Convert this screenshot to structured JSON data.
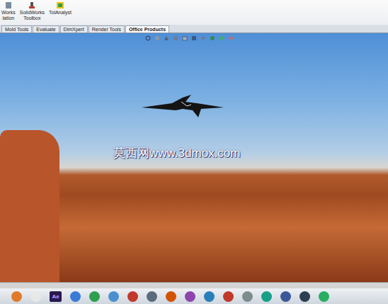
{
  "ribbon": {
    "items": [
      {
        "lines": [
          "Works",
          "lation"
        ]
      },
      {
        "lines": [
          "SolidWorks",
          "Toolbox"
        ]
      },
      {
        "lines": [
          "TolAnalyst"
        ]
      }
    ]
  },
  "tabs": [
    {
      "label": "Mold Tools",
      "selected": false
    },
    {
      "label": "Evaluate",
      "selected": false
    },
    {
      "label": "DimXpert",
      "selected": false
    },
    {
      "label": "Render Tools",
      "selected": false
    },
    {
      "label": "Office Products",
      "selected": true
    }
  ],
  "watermark": "莫西网www.3dmox.com",
  "taskbar": {
    "items": [
      {
        "kind": "icon",
        "color": "#e07a2a"
      },
      {
        "kind": "icon",
        "color": "#e8e8e8"
      },
      {
        "kind": "text",
        "label": "Ae"
      },
      {
        "kind": "icon",
        "color": "#3a7bd5"
      },
      {
        "kind": "icon",
        "color": "#2e9e4f"
      },
      {
        "kind": "icon",
        "color": "#4a90d0"
      },
      {
        "kind": "icon",
        "color": "#c0392b"
      },
      {
        "kind": "icon",
        "color": "#5a6b7c"
      },
      {
        "kind": "icon",
        "color": "#d35400"
      },
      {
        "kind": "icon",
        "color": "#8e44ad"
      },
      {
        "kind": "icon",
        "color": "#2980b9"
      },
      {
        "kind": "icon",
        "color": "#c0392b"
      },
      {
        "kind": "icon",
        "color": "#7f8c8d"
      },
      {
        "kind": "icon",
        "color": "#16a085"
      },
      {
        "kind": "icon",
        "color": "#3b5998"
      },
      {
        "kind": "icon",
        "color": "#2c3e50"
      },
      {
        "kind": "icon",
        "color": "#27ae60"
      }
    ]
  }
}
